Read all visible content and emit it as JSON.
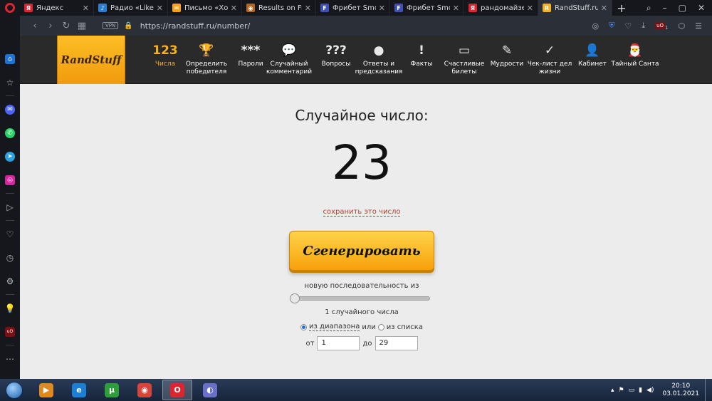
{
  "browser": {
    "tabs": [
      {
        "title": "Яндекс",
        "icon": "yandex-icon",
        "color": "#e0242f",
        "glyph": "Я"
      },
      {
        "title": "Радио «Like FM»",
        "icon": "radio-icon",
        "color": "#2a7fd4",
        "glyph": "♪"
      },
      {
        "title": "Письмо «Хо хо»",
        "icon": "mail-icon",
        "color": "#f6a21b",
        "glyph": "✉"
      },
      {
        "title": "Results on Free",
        "icon": "results-icon",
        "color": "#b5651d",
        "glyph": "◉"
      },
      {
        "title": "Фрибет SmokeC",
        "icon": "freebet-icon",
        "color": "#3f51b5",
        "glyph": "F"
      },
      {
        "title": "Фрибет SmokeC",
        "icon": "freebet-icon",
        "color": "#3f51b5",
        "glyph": "F"
      },
      {
        "title": "рандомайзер –",
        "icon": "yandex-icon",
        "color": "#e0242f",
        "glyph": "Я"
      },
      {
        "title": "RandStuff.ru – г",
        "icon": "randstuff-icon",
        "color": "#f7b021",
        "glyph": "R"
      }
    ],
    "url": "https://randstuff.ru/number/",
    "vpn": "VPN",
    "ublock_count": "1"
  },
  "site": {
    "logo": "RandStuff",
    "nav": [
      {
        "label": "Числа",
        "glyph": "123",
        "icon": "numbers-icon",
        "active": true
      },
      {
        "label": "Определить победителя",
        "glyph": "🏆",
        "icon": "trophy-icon",
        "active": false
      },
      {
        "label": "Пароли",
        "glyph": "***",
        "icon": "password-icon",
        "active": false
      },
      {
        "label": "Случайный комментарий",
        "glyph": "💬",
        "icon": "comment-icon",
        "active": false
      },
      {
        "label": "Вопросы",
        "glyph": "???",
        "icon": "questions-icon",
        "active": false
      },
      {
        "label": "Ответы и предсказания",
        "glyph": "●",
        "icon": "ball-icon",
        "active": false
      },
      {
        "label": "Факты",
        "glyph": "!",
        "icon": "facts-icon",
        "active": false
      },
      {
        "label": "Счастливые билеты",
        "glyph": "▭",
        "icon": "ticket-icon",
        "active": false
      },
      {
        "label": "Мудрости",
        "glyph": "✎",
        "icon": "wisdom-icon",
        "active": false
      },
      {
        "label": "Чек-лист дел жизни",
        "glyph": "✓",
        "icon": "checklist-icon",
        "active": false
      },
      {
        "label": "Кабинет",
        "glyph": "👤",
        "icon": "cabinet-icon",
        "active": false
      },
      {
        "label": "Тайный Санта",
        "glyph": "🎅",
        "icon": "santa-icon",
        "active": false
      }
    ],
    "heading": "Случайное число:",
    "number": "23",
    "save_link": "сохранить это число",
    "generate_button": "Сгенерировать",
    "sequence_label": "новую последовательность из",
    "sequence_value": 0,
    "count_label": "1 случайного числа",
    "mode_range": "из диапазона",
    "mode_or": "или",
    "mode_list": "из списка",
    "mode_selected": "range",
    "from_label": "от",
    "from_value": "1",
    "to_label": "до",
    "to_value": "29"
  },
  "taskbar": {
    "apps": [
      {
        "icon": "media-player-icon",
        "color": "#e08a1e",
        "glyph": "▶"
      },
      {
        "icon": "internet-explorer-icon",
        "color": "#1c7fd6",
        "glyph": "e"
      },
      {
        "icon": "uTorrent-icon",
        "color": "#2e9e3a",
        "glyph": "µ"
      },
      {
        "icon": "chrome-icon",
        "color": "#d84437",
        "glyph": "◉"
      },
      {
        "icon": "opera-icon",
        "color": "#e0242f",
        "glyph": "O"
      },
      {
        "icon": "bittorrent-icon",
        "color": "#6a6fc8",
        "glyph": "◐"
      }
    ],
    "time": "20:10",
    "date": "03.01.2021"
  }
}
